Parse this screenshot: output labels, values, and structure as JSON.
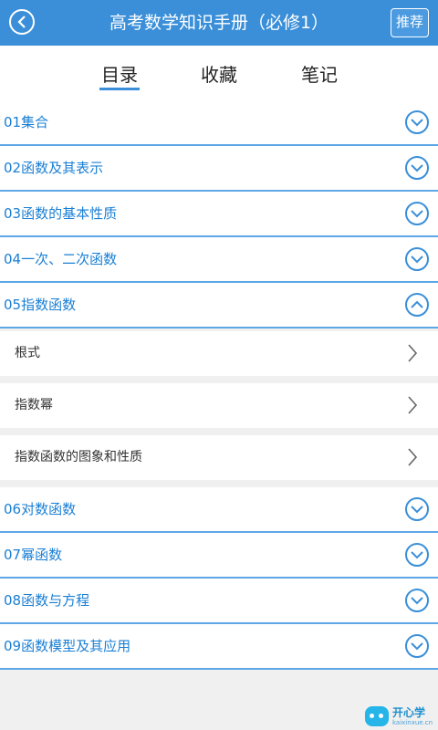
{
  "header": {
    "title": "高考数学知识手册（必修1）",
    "recommend_label": "推荐",
    "accent_color": "#3a8fd8"
  },
  "tabs": [
    {
      "label": "目录",
      "active": true
    },
    {
      "label": "收藏",
      "active": false
    },
    {
      "label": "笔记",
      "active": false
    }
  ],
  "chapters_before": [
    {
      "label": "01集合",
      "expanded": false
    },
    {
      "label": "02函数及其表示",
      "expanded": false
    },
    {
      "label": "03函数的基本性质",
      "expanded": false
    },
    {
      "label": "04一次、二次函数",
      "expanded": false
    }
  ],
  "expanded_chapter": {
    "label": "05指数函数",
    "expanded": true,
    "subitems": [
      {
        "label": "根式"
      },
      {
        "label": "指数幂"
      },
      {
        "label": "指数函数的图象和性质"
      }
    ]
  },
  "chapters_after": [
    {
      "label": "06对数函数",
      "expanded": false
    },
    {
      "label": "07幂函数",
      "expanded": false
    },
    {
      "label": "08函数与方程",
      "expanded": false
    },
    {
      "label": "09函数模型及其应用",
      "expanded": false
    }
  ],
  "watermark": {
    "text": "开心学",
    "url_text": "kaixinxue.cn"
  },
  "icons": {
    "back": "chevron-left-circle-icon",
    "collapsed": "chevron-down-circle-icon",
    "expanded": "chevron-up-circle-icon",
    "subitem": "chevron-right-icon"
  }
}
